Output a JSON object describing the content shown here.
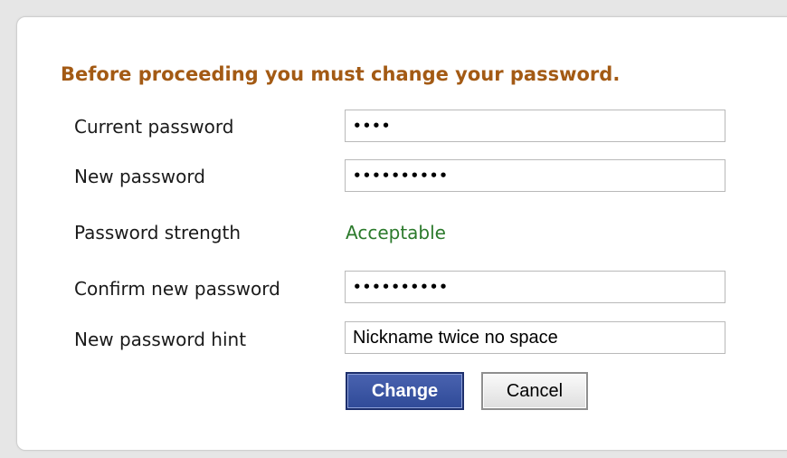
{
  "form": {
    "heading": "Before proceeding you must change your password.",
    "fields": {
      "current_password": {
        "label": "Current password",
        "value": "••••"
      },
      "new_password": {
        "label": "New password",
        "value": "••••••••••"
      },
      "password_strength": {
        "label": "Password strength",
        "value": "Acceptable"
      },
      "confirm_new_password": {
        "label": "Confirm new password",
        "value": "••••••••••"
      },
      "new_password_hint": {
        "label": "New password hint",
        "value": "Nickname twice no space"
      }
    },
    "buttons": {
      "change": "Change",
      "cancel": "Cancel"
    }
  },
  "colors": {
    "heading": "#a35a14",
    "strength_ok": "#2c7a2c",
    "primary_button": "#2f4a98"
  }
}
